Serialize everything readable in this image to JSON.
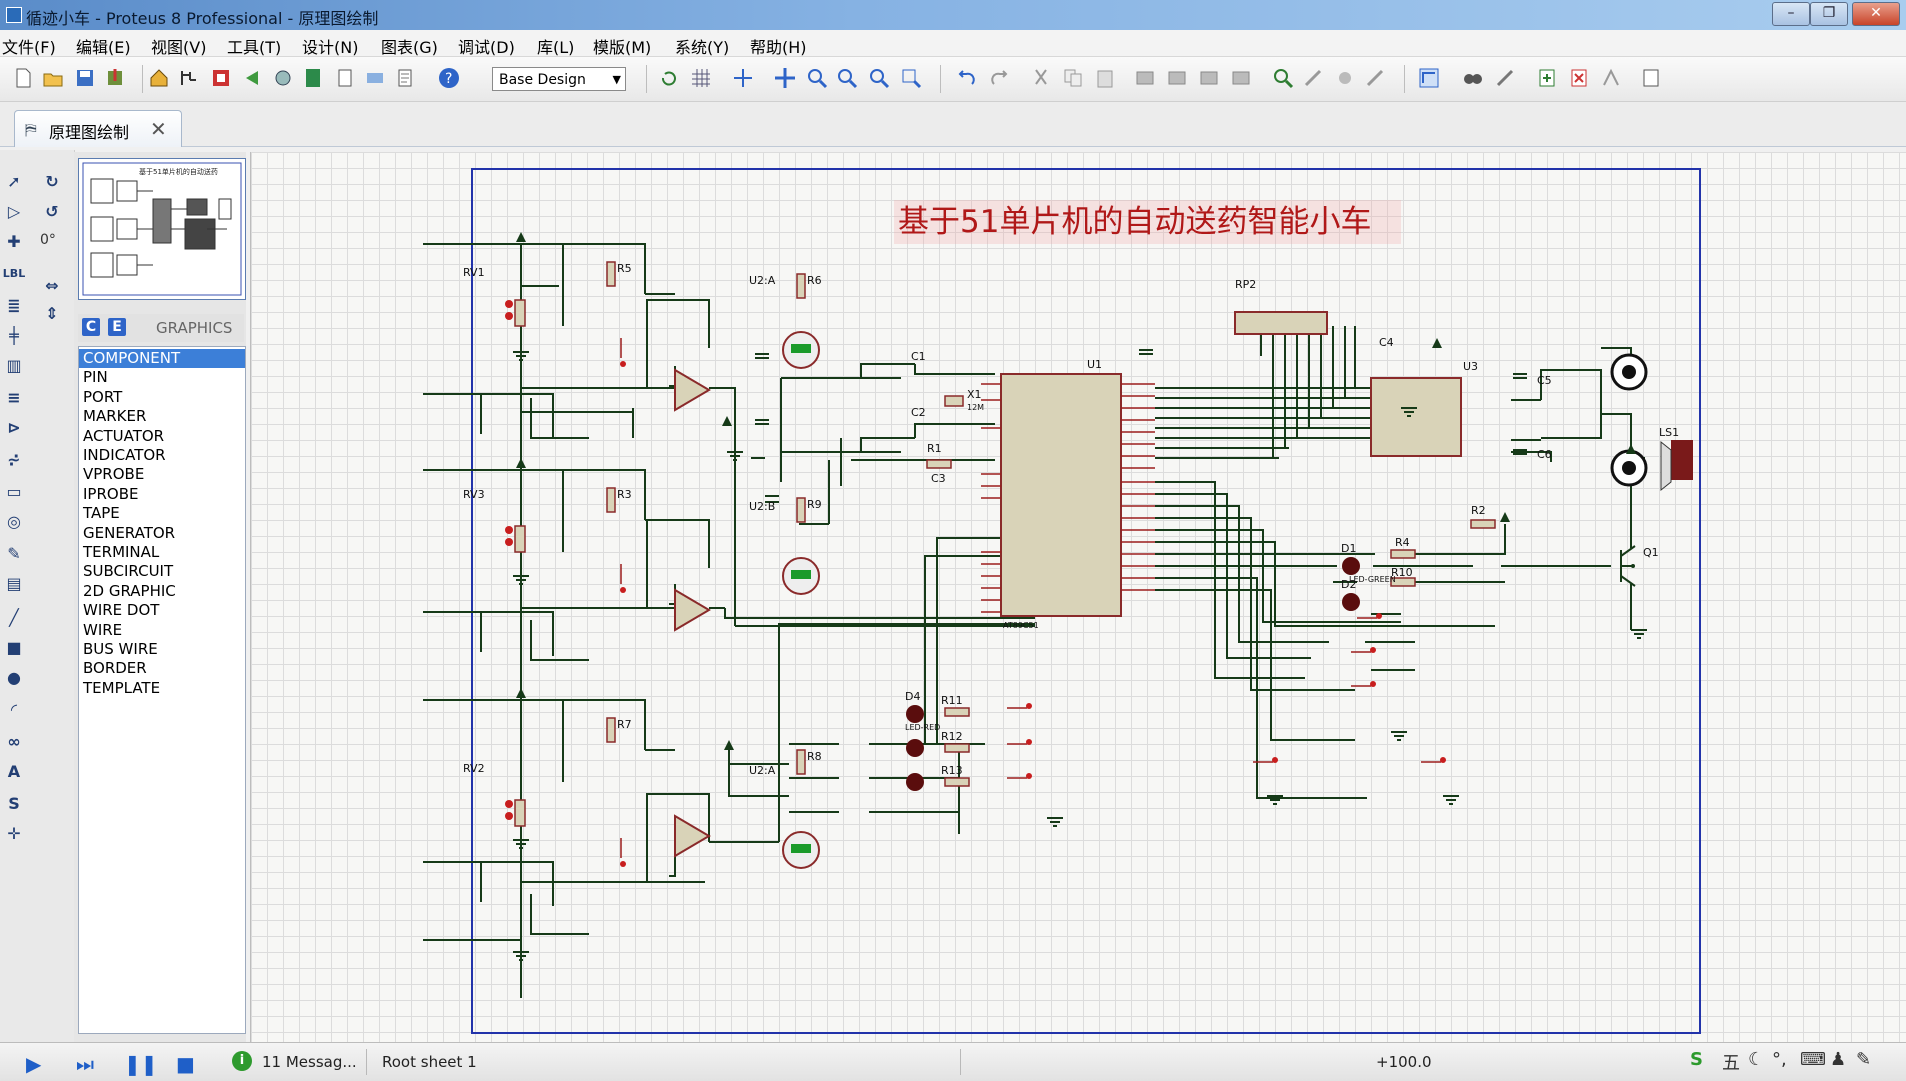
{
  "window": {
    "title": "循迹小车 - Proteus 8 Professional - 原理图绘制"
  },
  "menubar": {
    "items": [
      "文件(F)",
      "编辑(E)",
      "视图(V)",
      "工具(T)",
      "设计(N)",
      "图表(G)",
      "调试(D)",
      "库(L)",
      "模版(M)",
      "系统(Y)",
      "帮助(H)"
    ]
  },
  "toolbar": {
    "design_select_value": "Base Design"
  },
  "tabs": [
    {
      "label": "原理图绘制",
      "active": true
    }
  ],
  "toolstrip": {
    "rotation_angle": "0°"
  },
  "panel": {
    "c_button": "C",
    "e_button": "E",
    "mode_title": "GRAPHICS",
    "modes": [
      "COMPONENT",
      "PIN",
      "PORT",
      "MARKER",
      "ACTUATOR",
      "INDICATOR",
      "VPROBE",
      "IPROBE",
      "TAPE",
      "GENERATOR",
      "TERMINAL",
      "SUBCIRCUIT",
      "2D GRAPHIC",
      "WIRE DOT",
      "WIRE",
      "BUS WIRE",
      "BORDER",
      "TEMPLATE"
    ],
    "selected_mode": "COMPONENT"
  },
  "schematic": {
    "title": "基于51单片机的自动送药智能小车",
    "labels": {
      "rv1": "RV1",
      "rv3": "RV3",
      "rv2": "RV2",
      "r5": "R5",
      "r3": "R3",
      "r7": "R7",
      "r6": "R6",
      "r9": "R9",
      "r8": "R8",
      "u2a": "U2:A",
      "u2b": "U2:B",
      "u2a2": "U2:A",
      "rp2": "RP2",
      "u1": "U1",
      "x1": "X1",
      "c1": "C1",
      "c2": "C2",
      "c3": "C3",
      "c4": "C4",
      "c5": "C5",
      "c6": "C6",
      "r1": "R1",
      "r2": "R2",
      "r4": "R4",
      "r10": "R10",
      "r11": "R11",
      "r12": "R12",
      "r13": "R13",
      "d1": "D1",
      "d2": "D2",
      "d4": "D4",
      "u3": "U3",
      "ls1": "LS1",
      "q1": "Q1",
      "mcu_part": "AT89C51",
      "x1_val": "12M",
      "led_red": "LED-RED",
      "led_green": "LED-GREEN"
    }
  },
  "statusbar": {
    "messages": "11 Messag...",
    "sheet": "Root sheet 1",
    "coord": "+100.0",
    "ime_label": "五"
  },
  "colors": {
    "accent": "#3c7fd8",
    "sheet_border": "#2233aa",
    "wire": "#163a18",
    "component": "#9b1d1d",
    "title_red": "#b01818"
  }
}
